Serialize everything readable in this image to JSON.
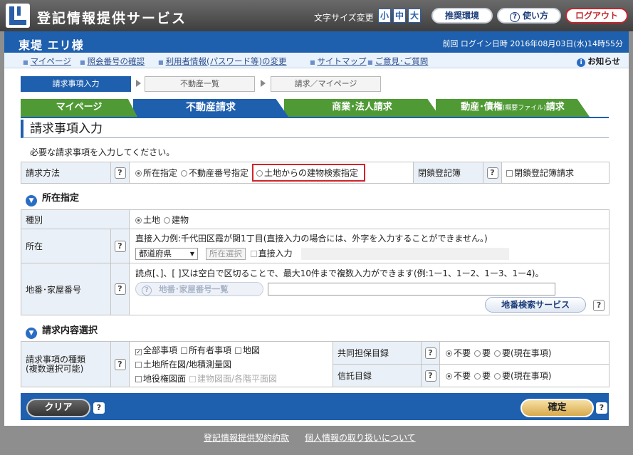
{
  "header": {
    "app_title": "登記情報提供サービス",
    "font_size_label": "文字サイズ変更",
    "font_sizes": [
      "小",
      "中",
      "大"
    ],
    "recommended_env": "推奨環境",
    "help": "使い方",
    "logout": "ログアウト"
  },
  "user": {
    "name": "東堤 エリ様",
    "last_login": "前回 ログイン日時 2016年08月03日(水)14時55分"
  },
  "links": {
    "mypage": "マイページ",
    "reference_number": "照会番号の確認",
    "user_info_change": "利用者情報(パスワード等)の変更",
    "sitemap": "サイトマップ",
    "feedback": "ご意見･ご質問",
    "notice": "お知らせ"
  },
  "steps": [
    "請求事項入力",
    "不動産一覧",
    "請求／マイページ"
  ],
  "tabs": {
    "mypage": "マイページ",
    "real_estate": "不動産請求",
    "commercial": "商業･法人請求",
    "movable_main": "動産･債権",
    "movable_small": "(概要ファイル)",
    "movable_suffix": "請求"
  },
  "page_title": "請求事項入力",
  "intro_text": "必要な請求事項を入力してください。",
  "method": {
    "label": "請求方法",
    "options": [
      "所在指定",
      "不動産番号指定",
      "土地からの建物検索指定"
    ],
    "closed_label": "閉鎖登記簿",
    "closed_option": "閉鎖登記簿請求"
  },
  "location_section": {
    "title": "所在指定",
    "type_label": "種別",
    "type_options": [
      "土地",
      "建物"
    ],
    "location_label": "所在",
    "location_note": "直接入力例:千代田区霞が関1丁目(直接入力の場合には、外字を入力することができません。)",
    "prefecture_select": "都道府県",
    "location_select_button": "所在選択",
    "direct_input": "直接入力",
    "lot_label": "地番･家屋番号",
    "lot_note": "読点[、]、[ ]又は空白で区切ることで、最大10件まで複数入力ができます(例:1ー1、1ー2、1ー3、1ー4)。",
    "lot_list_button": "地番･家屋番号一覧",
    "lot_search_service": "地番検索サービス"
  },
  "request_section": {
    "title": "請求内容選択",
    "kind_label_1": "請求事項の種類",
    "kind_label_2": "(複数選択可能)",
    "kinds": [
      "全部事項",
      "所有者事項",
      "地図",
      "土地所在図/地積測量図",
      "地役権図面",
      "建物図面/各階平面図"
    ],
    "joint_collateral_label": "共同担保目録",
    "trust_label": "信託目録",
    "need_options": [
      "不要",
      "要",
      "要(現在事項)"
    ]
  },
  "footer": {
    "clear": "クリア",
    "confirm": "確定",
    "terms": "登記情報提供契約約款",
    "privacy": "個人情報の取り扱いについて"
  }
}
